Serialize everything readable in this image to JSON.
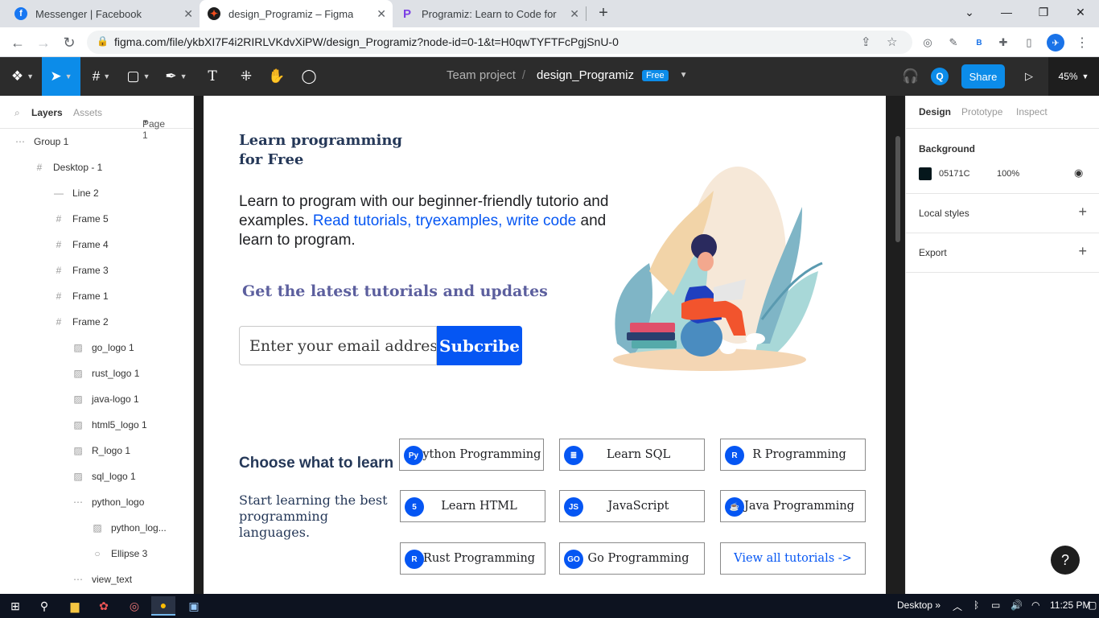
{
  "browser": {
    "tabs": [
      {
        "title": "Messenger | Facebook",
        "favicon": "facebook-icon",
        "color": "#1877f2"
      },
      {
        "title": "design_Programiz – Figma",
        "favicon": "figma-icon",
        "color": "#f24e1e"
      },
      {
        "title": "Programiz: Learn to Code for Fre",
        "favicon": "programiz-icon",
        "color": "#7b3fe4"
      }
    ],
    "url": "figma.com/file/ykbXI7F4i2RIRLVKdvXiPW/design_Programiz?node-id=0-1&t=H0qwTYFTFcPgjSnU-0",
    "ext_badge": "B"
  },
  "figma": {
    "project": "Team project",
    "file": "design_Programiz",
    "plan_badge": "Free",
    "user_initial": "Q",
    "share_label": "Share",
    "zoom": "45%"
  },
  "left_panel": {
    "tabs": {
      "layers": "Layers",
      "assets": "Assets",
      "page": "Page 1"
    },
    "layers": [
      {
        "name": "Group 1",
        "icon": "group-icon",
        "indent": 0
      },
      {
        "name": "Desktop - 1",
        "icon": "frame-icon",
        "indent": 1
      },
      {
        "name": "Line 2",
        "icon": "line-icon",
        "indent": 2
      },
      {
        "name": "Frame 5",
        "icon": "frame-icon",
        "indent": 2
      },
      {
        "name": "Frame 4",
        "icon": "frame-icon",
        "indent": 2
      },
      {
        "name": "Frame 3",
        "icon": "frame-icon",
        "indent": 2
      },
      {
        "name": "Frame 1",
        "icon": "frame-icon",
        "indent": 2
      },
      {
        "name": "Frame 2",
        "icon": "frame-icon",
        "indent": 3
      },
      {
        "name": "go_logo 1",
        "icon": "image-icon",
        "indent": 4
      },
      {
        "name": "rust_logo 1",
        "icon": "image-icon",
        "indent": 4
      },
      {
        "name": "java-logo 1",
        "icon": "image-icon",
        "indent": 4
      },
      {
        "name": "html5_logo 1",
        "icon": "image-icon",
        "indent": 4
      },
      {
        "name": "R_logo 1",
        "icon": "image-icon",
        "indent": 4
      },
      {
        "name": "sql_logo 1",
        "icon": "image-icon",
        "indent": 4
      },
      {
        "name": "python_logo",
        "icon": "group-icon",
        "indent": 4
      },
      {
        "name": "python_log...",
        "icon": "image-icon",
        "indent": 5
      },
      {
        "name": "Ellipse 3",
        "icon": "ellipse-icon",
        "indent": 5
      },
      {
        "name": "view_text",
        "icon": "group-icon",
        "indent": 4
      }
    ]
  },
  "canvas": {
    "hero_heading": [
      "Learn programming",
      "for Free"
    ],
    "hero_text_1": "Learn to program with our beginner-friendly tutorio and examples.",
    "hero_link": "Read tutorials, tryexamples, write code",
    "hero_text_2": "and learn to program.",
    "updates_heading": "Get the latest tutorials and updates",
    "email_placeholder": "Enter your email address",
    "subscribe_label": "Subcribe",
    "choose_heading": "Choose what to learn",
    "choose_sub": "Start learning the best programming languages.",
    "courses": [
      {
        "label": "Python Programming",
        "icon": "python-icon"
      },
      {
        "label": "Learn SQL",
        "icon": "database-icon"
      },
      {
        "label": "R Programming",
        "icon": "r-icon"
      },
      {
        "label": "Learn HTML",
        "icon": "html5-icon"
      },
      {
        "label": "JavaScript",
        "icon": "js-icon"
      },
      {
        "label": "Java Programming",
        "icon": "java-icon"
      },
      {
        "label": "Rust Programming",
        "icon": "rust-icon"
      },
      {
        "label": "Go Programming",
        "icon": "go-icon"
      },
      {
        "label": "View all tutorials ->",
        "icon": ""
      }
    ]
  },
  "right_panel": {
    "tabs": {
      "design": "Design",
      "prototype": "Prototype",
      "inspect": "Inspect"
    },
    "background_label": "Background",
    "background_hex": "05171C",
    "background_opacity": "100%",
    "local_styles": "Local styles",
    "export": "Export"
  },
  "taskbar": {
    "desktop_label": "Desktop",
    "time": "11:25 PM"
  },
  "colors": {
    "figma_blue": "#0c8ce9",
    "programiz_blue": "#0556f3",
    "heading_navy": "#253858"
  }
}
